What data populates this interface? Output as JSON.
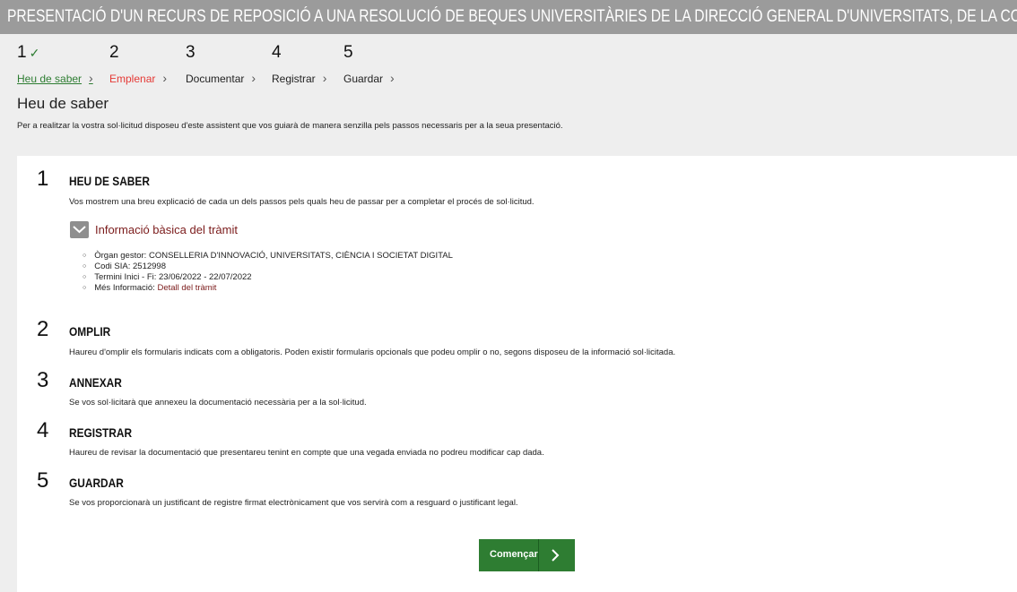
{
  "title": "PRESENTACIÓ D'UN RECURS DE REPOSICIÓ A UNA RESOLUCIÓ DE BEQUES UNIVERSITÀRIES DE LA DIRECCIÓ GENERAL D'UNIVERSITATS, DE LA CONSELLERIA D'IN",
  "steps": [
    {
      "number": "1",
      "label": "Heu de saber",
      "status": "done"
    },
    {
      "number": "2",
      "label": "Emplenar",
      "status": "active"
    },
    {
      "number": "3",
      "label": "Documentar",
      "status": "pending"
    },
    {
      "number": "4",
      "label": "Registrar",
      "status": "pending"
    },
    {
      "number": "5",
      "label": "Guardar",
      "status": "pending"
    }
  ],
  "breadcrumb_separator": "›",
  "section": {
    "title": "Heu de saber",
    "description": "Per a realitzar la vostra sol·licitud disposeu d'este assistent que vos guiarà de manera senzilla pels passos necessaris per a la seua presentació."
  },
  "items": [
    {
      "number": "1",
      "heading": "HEU DE SABER",
      "text": "Vos mostrem una breu explicació de cada un dels passos pels quals heu de passar per a completar el procés de sol·licitud."
    },
    {
      "number": "2",
      "heading": "OMPLIR",
      "text": "Haureu d'omplir els formularis indicats com a obligatoris. Poden existir formularis opcionals que podeu omplir o no, segons disposeu de la informació sol·licitada."
    },
    {
      "number": "3",
      "heading": "ANNEXAR",
      "text": "Se vos sol·licitarà que annexeu la documentació necessària per a la sol·licitud."
    },
    {
      "number": "4",
      "heading": "REGISTRAR",
      "text": "Haureu de revisar la documentació que presentareu tenint en compte que una vegada enviada no podreu modificar cap dada."
    },
    {
      "number": "5",
      "heading": "GUARDAR",
      "text": "Se vos proporcionarà un justificant de registre firmat electrònicament que vos servirà com a resguard o justificant legal."
    }
  ],
  "info": {
    "title": "Informació bàsica del tràmit",
    "organ": "Òrgan gestor: CONSELLERIA D'INNOVACIÓ, UNIVERSITATS, CIÈNCIA I SOCIETAT DIGITAL",
    "codi": "Codi SIA: 2512998",
    "termini": "Termini Inici - Fi: 23/06/2022 - 22/07/2022",
    "mes_label": "Més Informació: ",
    "mes_link": "Detall del tràmit"
  },
  "button": {
    "label": "Començar",
    "arrow": "›"
  },
  "colors": {
    "green": "#2e7d32",
    "red": "#e53935",
    "maroon": "#7b1b1b",
    "gray_header": "#9b9b9b"
  }
}
